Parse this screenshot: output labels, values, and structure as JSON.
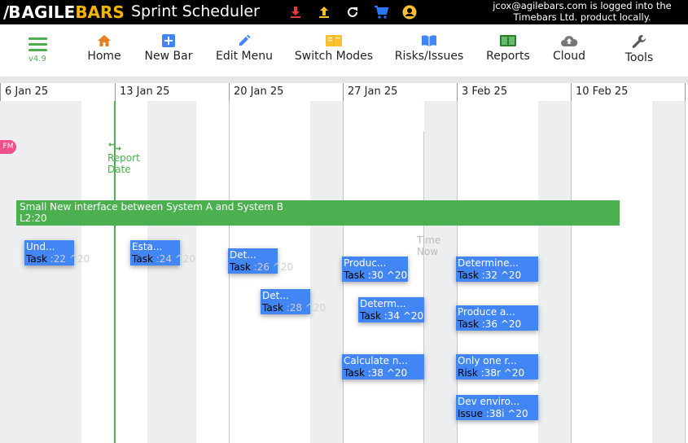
{
  "app": {
    "logo_mark": "/B",
    "logo_agile": "AGILE",
    "logo_bars": "BARS",
    "title": "Sprint Scheduler",
    "user_message_line1": "jcox@agilebars.com is logged into the",
    "user_message_line2": "Timebars Ltd. product locally.",
    "version": "v4.9"
  },
  "top_icons": [
    {
      "name": "download-icon",
      "color": "#e53935"
    },
    {
      "name": "upload-icon",
      "color": "#fbc02d"
    },
    {
      "name": "refresh-icon",
      "color": "#ffffff"
    },
    {
      "name": "cart-icon",
      "color": "#2979ff"
    },
    {
      "name": "account-icon",
      "color": "#fbc02d"
    }
  ],
  "toolbar": {
    "home": "Home",
    "new_bar": "New Bar",
    "edit_menu": "Edit Menu",
    "switch_modes": "Switch Modes",
    "risks_issues": "Risks/Issues",
    "reports": "Reports",
    "cloud": "Cloud",
    "tools": "Tools"
  },
  "timeline": {
    "columns": [
      "6 Jan 25",
      "13 Jan 25",
      "20 Jan 25",
      "27 Jan 25",
      "3 Feb 25",
      "10 Feb 25"
    ],
    "report_date_label_1": "Report",
    "report_date_label_2": "Date",
    "time_now_1": "Time",
    "time_now_2": "Now",
    "fm_badge": "FM"
  },
  "epic": {
    "title": "Small New interface between System A and System B",
    "subtitle": "L2:20"
  },
  "tasks": [
    {
      "title": "Und...",
      "type": "Task",
      "code": ":22 ^20"
    },
    {
      "title": "Esta...",
      "type": "Task",
      "code": ":24 ^20"
    },
    {
      "title": "Det...",
      "type": "Task",
      "code": ":26 ^20"
    },
    {
      "title": "Det...",
      "type": "Task",
      "code": ":28 ^20"
    },
    {
      "title": "Produc...",
      "type": "Task",
      "code": ":30 ^20"
    },
    {
      "title": "Determ...",
      "type": "Task",
      "code": ":34 ^20"
    },
    {
      "title": "Calculate n...",
      "type": "Task",
      "code": ":38 ^20"
    },
    {
      "title": "Determine...",
      "type": "Task",
      "code": ":32 ^20"
    },
    {
      "title": "Produce a...",
      "type": "Task",
      "code": ":36 ^20"
    },
    {
      "title": "Only one r...",
      "type": "Risk",
      "code": ":38r ^20"
    },
    {
      "title": "Dev enviro...",
      "type": "Issue",
      "code": ":38i ^20"
    }
  ]
}
